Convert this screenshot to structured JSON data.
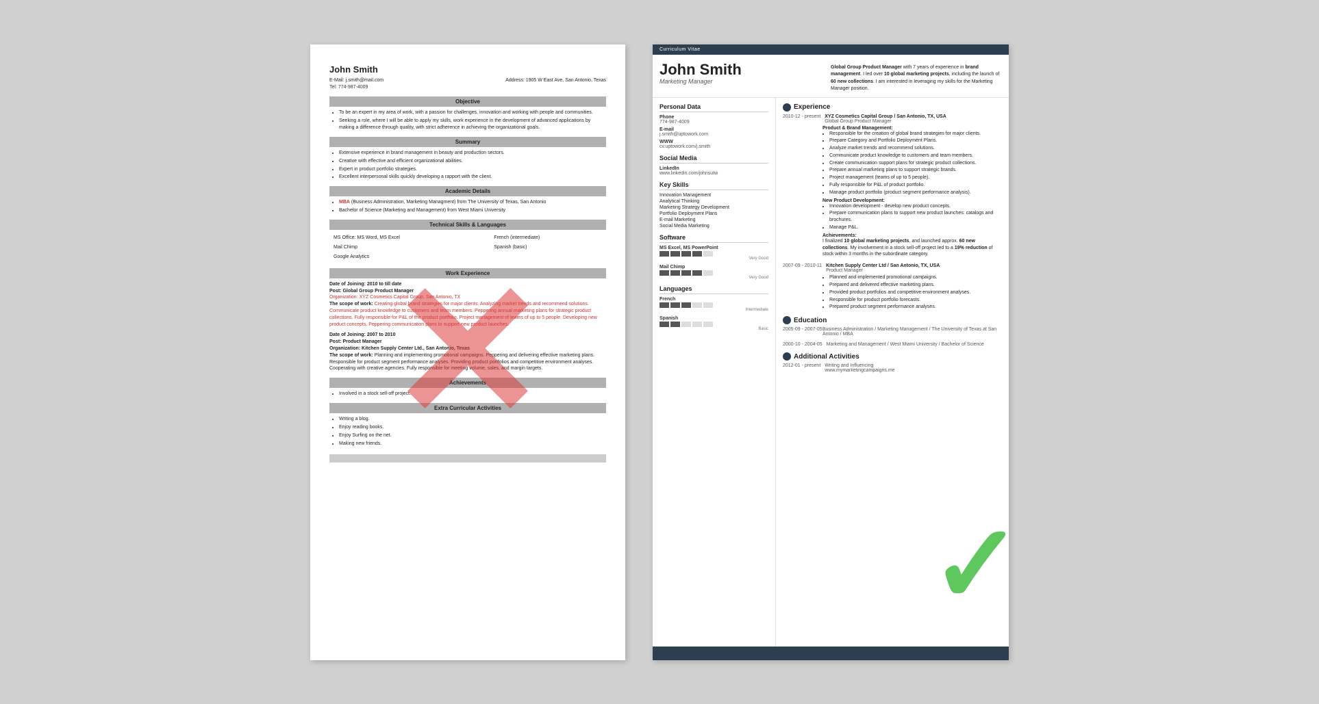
{
  "left_resume": {
    "name": "John Smith",
    "email": "E-Mail: j.smith@mail.com",
    "address": "Address: 1905 W East Ave, San Antonio, Texas",
    "tel": "Tel: 774-987-4009",
    "objective_title": "Objective",
    "objective_items": [
      "To be an expert in my area of work, with a passion for challenges, innovation and working with people and communities.",
      "Seeking a role, where I will be able to apply my skills, work experience in the development of advanced applications by making a difference through quality, with strict adherence in achieving the organizational goals."
    ],
    "summary_title": "Summary",
    "summary_items": [
      "Extensive experience in brand management in beauty and production sectors.",
      "Creative with effective and efficient organizational abilities.",
      "Expert in product portfolio strategies.",
      "Excellent interpersonal skills quickly developing a rapport with the client."
    ],
    "academic_title": "Academic Details",
    "academic_items": [
      "MBA (Business Administration, Marketing Managment) from The University of Texas, San Antonio",
      "Bachelor of Science (Marketing and Management) from West Miami University"
    ],
    "technical_title": "Technical Skills & Languages",
    "skills_left": [
      "MS Office: MS Word, MS Excel",
      "Mail Chimp",
      "Google Analytics"
    ],
    "skills_right": [
      "French (intermediate)",
      "Spanish (basic)"
    ],
    "work_title": "Work Experience",
    "work_entries": [
      {
        "date": "Date of Joining: 2010 to till date",
        "post": "Post: Global Group Product Manager",
        "org": "Organization: XYZ Cosmetics Capital Group, San Antonio, TX",
        "scope_label": "The scope of work:",
        "scope_text": " Creating global brand strategies for major clients. Analyzing market trends and recommend solutions. Communicate product knowledge to customers and team members. Peppering annual marketing plans for strategic product collections. Fully responsible for P&L of the product portfolio. Project management of teams of up to 5 people. Developing new product concepts. Peppering communication plans to support new product launches."
      },
      {
        "date": "Date of Joining: 2007 to 2010",
        "post": "Post: Product Manager",
        "org": "Organization: Kitchen Supply Center Ltd., San Antonio, Texas",
        "scope_label": "The scope of work:",
        "scope_text": " Planning and implementing promotional campaigns. Peppering and delivering effective marketing plans. Responsible for product segment performance analyses. Providing product portfolios and competitive environment analyses. Cooperating with creative agencies. Fully responsible for meeting volume, sales, and margin targets."
      }
    ],
    "achievements_title": "Achievements",
    "achievements_items": [
      "Involved in a stock sell-off project."
    ],
    "extra_title": "Extra Curricular Activities",
    "extra_items": [
      "Writing a blog.",
      "Enjoy reading books.",
      "Enjoy Surfing on the net.",
      "Making new friends."
    ]
  },
  "right_resume": {
    "cv_label": "Curriculum Vitae",
    "name": "John Smith",
    "job_title": "Marketing Manager",
    "summary": "Global Group Product Manager with 7 years of experience in brand management. I led over 10 global marketing projects, including the launch of 60 new collections. I am interested in leveraging my skills for the Marketing Manager position.",
    "personal_data_title": "Personal Data",
    "phone_label": "Phone",
    "phone_value": "774-987-4009",
    "email_label": "E-mail",
    "email_value": "j.smith@uptowork.com",
    "www_label": "WWW",
    "www_value": "cv.uptowork.com/j.smith",
    "social_media_title": "Social Media",
    "linkedin_label": "LinkedIn",
    "linkedin_value": "www.linkedin.com/johnsutw",
    "skills_title": "Key Skills",
    "skills": [
      "Innovation Management",
      "Analytical Thinking",
      "Marketing Strategy Development",
      "Portfolio Deployment Plans",
      "E-mail Marketing",
      "Social Media Marketing"
    ],
    "software_title": "Software",
    "software_items": [
      {
        "name": "MS Excel, MS PowerPoint",
        "level": 4,
        "label": "Very Good"
      },
      {
        "name": "Mail Chimp",
        "level": 4,
        "label": "Very Good"
      }
    ],
    "languages_title": "Languages",
    "languages": [
      {
        "name": "French",
        "level": 3,
        "label": "Intermediate"
      },
      {
        "name": "Spanish",
        "level": 2,
        "label": "Basic"
      }
    ],
    "experience_title": "Experience",
    "experience": [
      {
        "dates": "2010-12 - present",
        "org": "XYZ Cosmetics Capital Group / San Antonio, TX, USA",
        "role": "Global Group Product Manager",
        "sub1": "Product & Brand Management:",
        "bullets1": [
          "Responsible for the creation of global brand strategies for major clients.",
          "Prepare Category and Portfolio Deployment Plans.",
          "Analyze market trends and recommend solutions.",
          "Communicate product knowledge to customers and team members.",
          "Create communication support plans for strategic product collections.",
          "Prepare annual marketing plans to support strategic brands.",
          "Project management (teams of up to 5 people).",
          "Fully responsible for P&L of product portfolio.",
          "Manage product portfolio (product segment performance analysis)."
        ],
        "sub2": "New Product Development:",
        "bullets2": [
          "Innovation development - develop new product concepts.",
          "Prepare communication plans to support new product launches: catalogs and brochures.",
          "Manage P&L."
        ],
        "sub3": "Achievements:",
        "achievements_text": "I finalized 10 global marketing projects, and launched approx. 60 new collections. My involvement in a stock sell-off project led to a 19% reduction of stock within 3 months in the subordinate category."
      },
      {
        "dates": "2007-09 - 2010-11",
        "org": "Kitchen Supply Center Ltd / San Antonio, TX, USA",
        "role": "Product Manager",
        "bullets1": [
          "Planned and implemented promotional campaigns.",
          "Prepared and delivered effective marketing plans.",
          "Provided product portfolios and competitive environment analyses.",
          "Responsible for product portfolio forecasts.",
          "Prepared product segment performance analyses."
        ]
      }
    ],
    "education_title": "Education",
    "education": [
      {
        "dates": "2005-09 - 2007-05",
        "desc": "Business Administration / Marketing Management / The University of Texas at San Antonio / MBA"
      },
      {
        "dates": "2000-10 - 2004-05",
        "desc": "Marketing and Management / West Miami University / Bachelor of Science"
      }
    ],
    "additional_title": "Additional Activities",
    "additional": [
      {
        "dates": "2012-01 - present",
        "desc": "Writing and Influencing",
        "url": "www.mymarketingcampaigns.me"
      }
    ]
  }
}
